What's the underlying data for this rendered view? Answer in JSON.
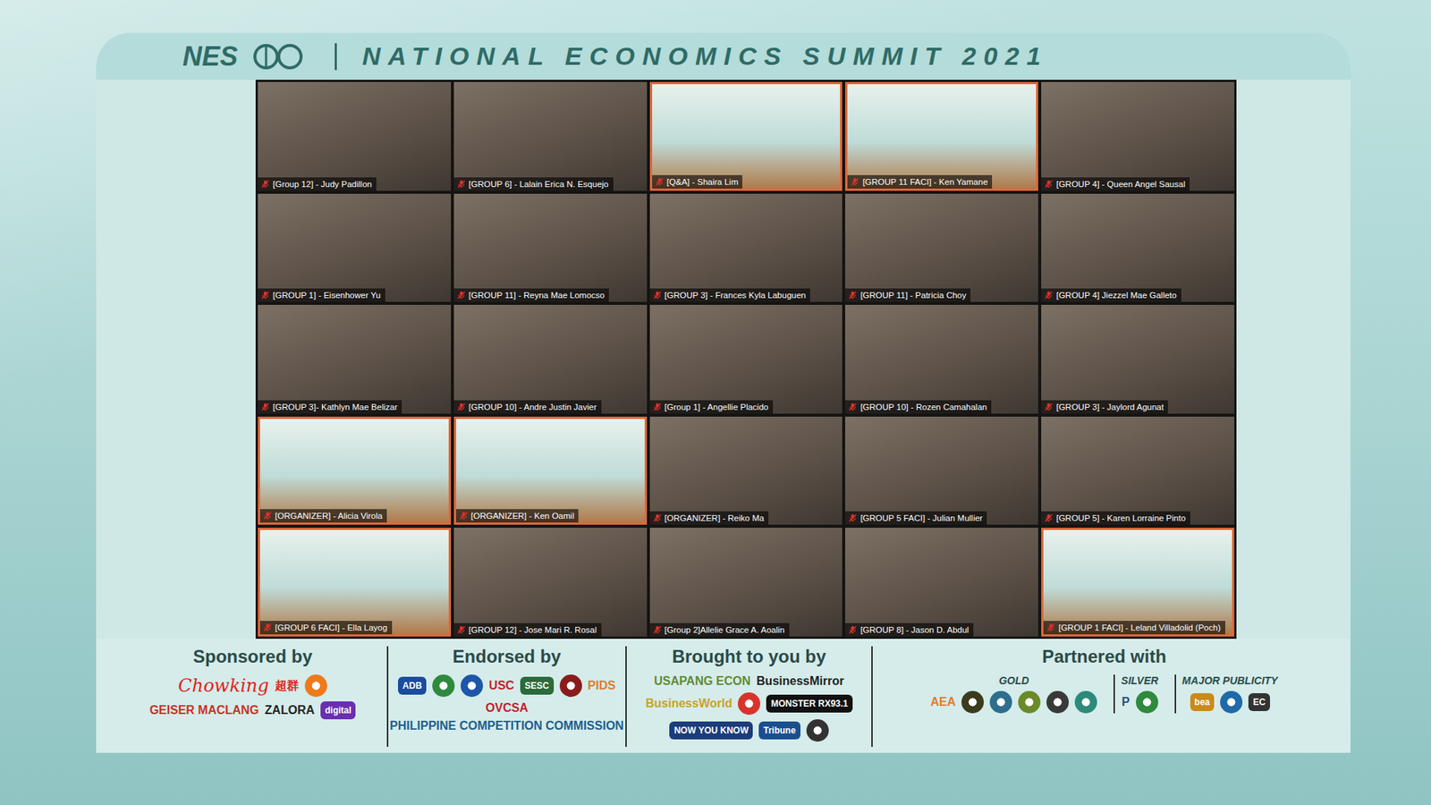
{
  "header": {
    "logo": "NES",
    "title": "NATIONAL ECONOMICS SUMMIT 2021"
  },
  "participants": [
    {
      "name": "[Group 12] - Judy Padillon",
      "muted": true,
      "kind": "camera"
    },
    {
      "name": "[GROUP 6] - Lalain Erica N. Esquejo",
      "muted": true,
      "kind": "camera"
    },
    {
      "name": "[Q&A] - Shaira Lim",
      "muted": true,
      "kind": "background"
    },
    {
      "name": "[GROUP 11 FACI] - Ken Yamane",
      "muted": true,
      "kind": "background"
    },
    {
      "name": "[GROUP 4] - Queen Angel Sausal",
      "muted": true,
      "kind": "camera"
    },
    {
      "name": "[GROUP 1] - Eisenhower Yu",
      "muted": true,
      "kind": "camera"
    },
    {
      "name": "[GROUP 11] - Reyna Mae Lomocso",
      "muted": true,
      "kind": "camera"
    },
    {
      "name": "[GROUP 3] - Frances Kyla Labuguen",
      "muted": true,
      "kind": "camera"
    },
    {
      "name": "[GROUP 11] - Patricia Choy",
      "muted": true,
      "kind": "camera"
    },
    {
      "name": "[GROUP 4] Jiezzel Mae Galleto",
      "muted": true,
      "kind": "camera"
    },
    {
      "name": "[GROUP 3]- Kathlyn Mae Belizar",
      "muted": true,
      "kind": "camera"
    },
    {
      "name": "[GROUP 10] - Andre Justin Javier",
      "muted": true,
      "kind": "camera"
    },
    {
      "name": "[Group 1] - Angellie Placido",
      "muted": true,
      "kind": "camera"
    },
    {
      "name": "[GROUP 10] - Rozen Camahalan",
      "muted": true,
      "kind": "camera"
    },
    {
      "name": "[GROUP 3] - Jaylord Agunat",
      "muted": true,
      "kind": "camera"
    },
    {
      "name": "[ORGANIZER] - Alicia Virola",
      "muted": true,
      "kind": "background"
    },
    {
      "name": "[ORGANIZER] - Ken Oamil",
      "muted": true,
      "kind": "background"
    },
    {
      "name": "[ORGANIZER] - Reiko Ma",
      "muted": true,
      "kind": "camera"
    },
    {
      "name": "[GROUP 5 FACI] - Julian Mullier",
      "muted": true,
      "kind": "camera"
    },
    {
      "name": "[GROUP 5] - Karen Lorraine Pinto",
      "muted": true,
      "kind": "camera"
    },
    {
      "name": "[GROUP 6 FACI] - Ella Layog",
      "muted": true,
      "kind": "background"
    },
    {
      "name": "[GROUP 12] - Jose Mari R. Rosal",
      "muted": true,
      "kind": "camera"
    },
    {
      "name": "[Group 2]Allelie Grace A. Aoalin",
      "muted": true,
      "kind": "camera"
    },
    {
      "name": "[GROUP 8] - Jason D. Abdul",
      "muted": true,
      "kind": "camera"
    },
    {
      "name": "[GROUP 1 FACI] - Leland Villadolid (Poch)",
      "muted": true,
      "kind": "background"
    }
  ],
  "sections": [
    {
      "title": "Sponsored by",
      "groups": [
        {
          "logos": [
            {
              "kind": "script",
              "text": "Chowking",
              "color": "#e2231a"
            },
            {
              "kind": "word",
              "text": "超群",
              "color": "#e2231a"
            },
            {
              "kind": "seal",
              "color": "#f07a1a"
            },
            {
              "kind": "word",
              "text": "GEISER MACLANG",
              "color": "#c8321f"
            },
            {
              "kind": "word",
              "text": "ZALORA",
              "color": "#222222"
            },
            {
              "kind": "badge",
              "text": "digital",
              "color": "#6a2fb0"
            }
          ]
        }
      ]
    },
    {
      "title": "Endorsed by",
      "groups": [
        {
          "logos": [
            {
              "kind": "badge",
              "text": "ADB",
              "color": "#1a4c9c"
            },
            {
              "kind": "seal",
              "color": "#2f8a3e"
            },
            {
              "kind": "seal",
              "color": "#1e56a8"
            },
            {
              "kind": "word",
              "text": "USC",
              "color": "#c21e2b"
            },
            {
              "kind": "badge",
              "text": "SESC",
              "color": "#2a6b3a"
            },
            {
              "kind": "seal",
              "color": "#8a1c1c"
            },
            {
              "kind": "word",
              "text": "PIDS",
              "color": "#e07b2a"
            },
            {
              "kind": "word",
              "text": "OVCSA",
              "color": "#c21e2b"
            },
            {
              "kind": "word",
              "text": "PHILIPPINE COMPETITION COMMISSION",
              "color": "#1e5d8c"
            }
          ]
        }
      ]
    },
    {
      "title": "Brought to you by",
      "groups": [
        {
          "logos": [
            {
              "kind": "word",
              "text": "USAPANG ECON",
              "color": "#5f8a34"
            },
            {
              "kind": "word",
              "text": "BusinessMirror",
              "color": "#1e1e1e"
            },
            {
              "kind": "word",
              "text": "BusinessWorld",
              "color": "#c9a227"
            },
            {
              "kind": "seal",
              "color": "#d8342b"
            },
            {
              "kind": "badge",
              "text": "MONSTER RX93.1",
              "color": "#111111"
            },
            {
              "kind": "badge",
              "text": "NOW YOU KNOW",
              "color": "#1c3c7a"
            },
            {
              "kind": "badge",
              "text": "Tribune",
              "color": "#1a4f8f"
            },
            {
              "kind": "seal",
              "color": "#333333"
            }
          ]
        }
      ]
    },
    {
      "title": "Partnered with",
      "groups": [
        {
          "label": "GOLD",
          "logos": [
            {
              "kind": "word",
              "text": "AEA",
              "color": "#e07b2a"
            },
            {
              "kind": "seal",
              "color": "#3b3b1e"
            },
            {
              "kind": "seal",
              "color": "#2d6e8c"
            },
            {
              "kind": "seal",
              "color": "#6b8a2a"
            },
            {
              "kind": "seal",
              "color": "#3a3a3a"
            },
            {
              "kind": "seal",
              "color": "#2e8a7a"
            }
          ]
        },
        {
          "label": "SILVER",
          "logos": [
            {
              "kind": "word",
              "text": "P",
              "color": "#2a4b7c"
            },
            {
              "kind": "seal",
              "color": "#2f8a3e"
            }
          ]
        },
        {
          "label": "MAJOR PUBLICITY",
          "logos": [
            {
              "kind": "badge",
              "text": "bea",
              "color": "#c98a1a"
            },
            {
              "kind": "seal",
              "color": "#1f6aa8"
            },
            {
              "kind": "badge",
              "text": "EC",
              "color": "#333333"
            }
          ]
        }
      ]
    }
  ]
}
